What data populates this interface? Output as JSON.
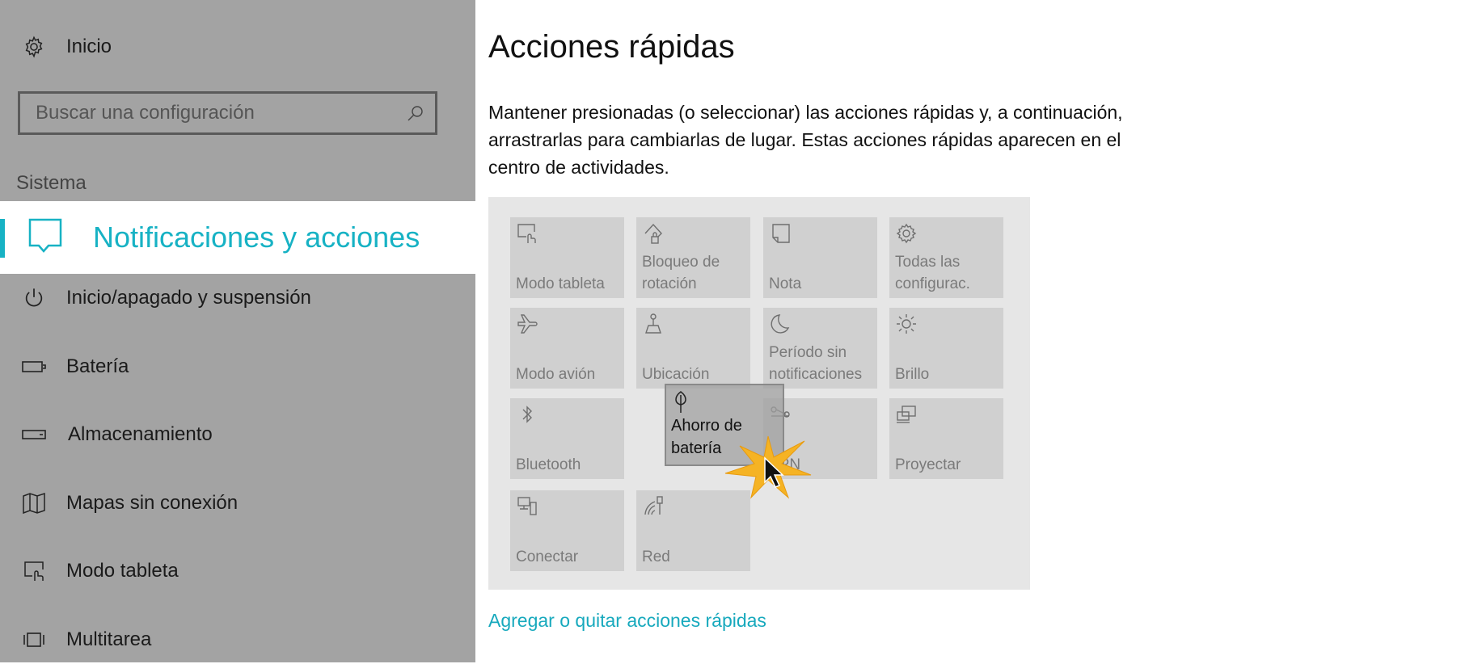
{
  "sidebar": {
    "home_label": "Inicio",
    "search_placeholder": "Buscar una configuración",
    "section_label": "Sistema",
    "selected_item": "Notificaciones y acciones",
    "items": [
      {
        "label": "Inicio/apagado y suspensión",
        "icon": "power-icon"
      },
      {
        "label": "Batería",
        "icon": "battery-icon"
      },
      {
        "label": "Almacenamiento",
        "icon": "storage-icon"
      },
      {
        "label": "Mapas sin conexión",
        "icon": "map-icon"
      },
      {
        "label": "Modo tableta",
        "icon": "tablet-icon"
      },
      {
        "label": "Multitarea",
        "icon": "multitask-icon"
      }
    ]
  },
  "main": {
    "title": "Acciones rápidas",
    "description": "Mantener presionadas (o seleccionar) las acciones rápidas y, a continuación, arrastrarlas para cambiarlas de lugar. Estas acciones rápidas aparecen en el centro de actividades.",
    "tiles": [
      {
        "label": "Modo tableta",
        "icon": "tablet-mode-icon"
      },
      {
        "label": "Bloqueo de rotación",
        "icon": "rotation-lock-icon"
      },
      {
        "label": "Nota",
        "icon": "note-icon"
      },
      {
        "label": "Todas las configurac.",
        "icon": "gear-icon"
      },
      {
        "label": "Modo avión",
        "icon": "airplane-icon"
      },
      {
        "label": "Ubicación",
        "icon": "location-icon"
      },
      {
        "label": "Período sin notificaciones",
        "icon": "moon-icon"
      },
      {
        "label": "Brillo",
        "icon": "brightness-icon"
      },
      {
        "label": "Bluetooth",
        "icon": "bluetooth-icon"
      },
      {
        "label": "VPN",
        "icon": "vpn-icon"
      },
      {
        "label": "Proyectar",
        "icon": "project-icon"
      },
      {
        "label": "Conectar",
        "icon": "connect-icon"
      },
      {
        "label": "Red",
        "icon": "network-icon"
      }
    ],
    "dragged_tile": {
      "label": "Ahorro de batería",
      "icon": "leaf-icon"
    },
    "link": "Agregar o quitar acciones rápidas"
  },
  "colors": {
    "accent": "#17b2c4",
    "sidebar_bg": "#a3a3a3",
    "panel_bg": "#e6e6e6",
    "tile_bg": "#d0d0d0"
  }
}
